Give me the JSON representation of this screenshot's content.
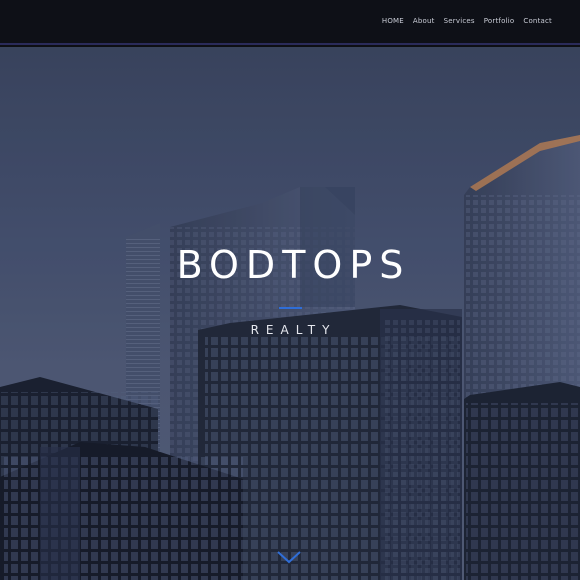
{
  "nav": {
    "items": [
      {
        "label": "HOME"
      },
      {
        "label": "About"
      },
      {
        "label": "Services"
      },
      {
        "label": "Portfolio"
      },
      {
        "label": "Contact"
      }
    ]
  },
  "hero": {
    "title": "BODTOPS",
    "subtitle": "REALTY",
    "background": "city-skyline-photo",
    "scroll_icon": "chevron-down-icon"
  },
  "colors": {
    "navbar": "#0e1017",
    "accent": "#2f6ed8",
    "text": "#ffffff"
  }
}
